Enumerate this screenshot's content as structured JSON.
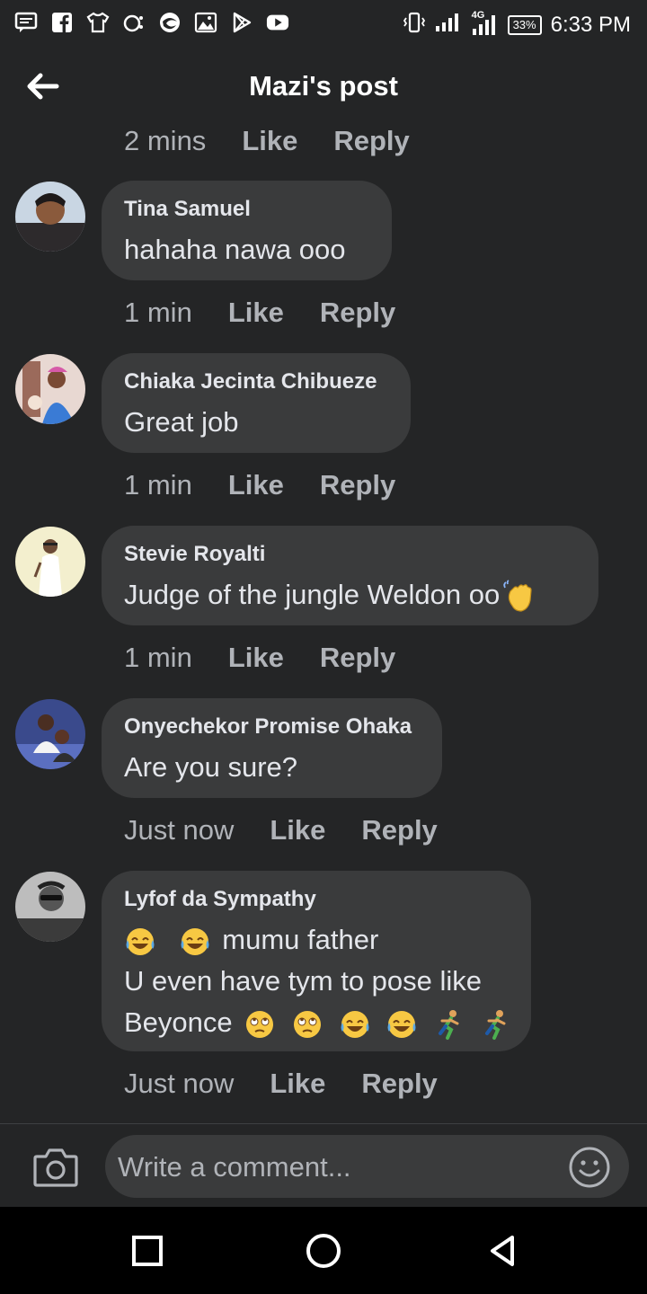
{
  "status_bar": {
    "battery": "33%",
    "time": "6:33 PM",
    "network": "4G"
  },
  "header": {
    "title": "Mazi's post"
  },
  "top_meta": {
    "time": "2 mins",
    "like": "Like",
    "reply": "Reply"
  },
  "comments": [
    {
      "name": "Tina Samuel",
      "text": "hahaha nawa ooo",
      "time": "1 min",
      "like": "Like",
      "reply": "Reply"
    },
    {
      "name": "Chiaka Jecinta Chibueze",
      "text": "Great job",
      "time": "1 min",
      "like": "Like",
      "reply": "Reply"
    },
    {
      "name": "Stevie Royalti",
      "text": "Judge of the jungle Weldon oo",
      "time": "1 min",
      "like": "Like",
      "reply": "Reply"
    },
    {
      "name": "Onyechekor Promise Ohaka",
      "text": "Are you sure?",
      "time": "Just now",
      "like": "Like",
      "reply": "Reply"
    },
    {
      "name": "Lyfof da Sympathy",
      "line1": "mumu father",
      "line2": "U even have tym to pose like",
      "line3": "Beyonce",
      "time": "Just now",
      "like": "Like",
      "reply": "Reply"
    }
  ],
  "composer": {
    "placeholder": "Write a comment..."
  },
  "icons": {
    "back": "arrow-left-icon",
    "camera": "camera-icon",
    "emoji": "smiley-icon",
    "nav_recent": "square-icon",
    "nav_home": "circle-icon",
    "nav_back": "triangle-back-icon"
  },
  "colors": {
    "background": "#242526",
    "bubble": "#3a3b3c",
    "text": "#e4e6eb",
    "secondary_text": "#b0b3b8"
  }
}
